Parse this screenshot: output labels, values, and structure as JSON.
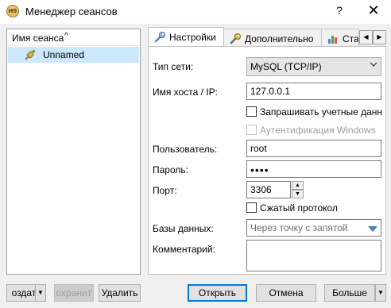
{
  "window": {
    "title": "Менеджер сеансов",
    "app_icon_text": "HS",
    "help": "?",
    "close": "✕"
  },
  "sessions": {
    "header": "Имя сеанса",
    "sort_indicator": "^",
    "items": [
      {
        "label": "Unnamed",
        "selected": true
      }
    ]
  },
  "tabs": {
    "items": [
      {
        "label": "Настройки",
        "icon": "wrench-icon",
        "active": true
      },
      {
        "label": "Дополнительно",
        "icon": "wrench-icon",
        "active": false
      },
      {
        "label": "Ста",
        "icon": "chart-icon",
        "active": false
      }
    ],
    "scroll_left": "◀",
    "scroll_right": "▶"
  },
  "settings": {
    "network_type_label": "Тип сети:",
    "network_type_value": "MySQL (TCP/IP)",
    "host_label": "Имя хоста / IP:",
    "host_value": "127.0.0.1",
    "prompt_credentials_label": "Запрашивать учетные данн",
    "windows_auth_label": "Аутентификация Windows",
    "user_label": "Пользователь:",
    "user_value": "root",
    "password_label": "Пароль:",
    "password_value": "••••",
    "port_label": "Порт:",
    "port_value": "3306",
    "compressed_label": "Сжатый протокол",
    "databases_label": "Базы данных:",
    "databases_placeholder": "Через точку с запятой",
    "comment_label": "Комментарий:",
    "comment_value": ""
  },
  "buttons": {
    "new": "оздат",
    "save": "охранит",
    "delete": "Удалить",
    "open": "Открыть",
    "cancel": "Отмена",
    "more": "Больше"
  },
  "colors": {
    "selection": "#cce8ff",
    "default_button_border": "#0078d7",
    "dropdown_arrow": "#4a7fc1"
  }
}
